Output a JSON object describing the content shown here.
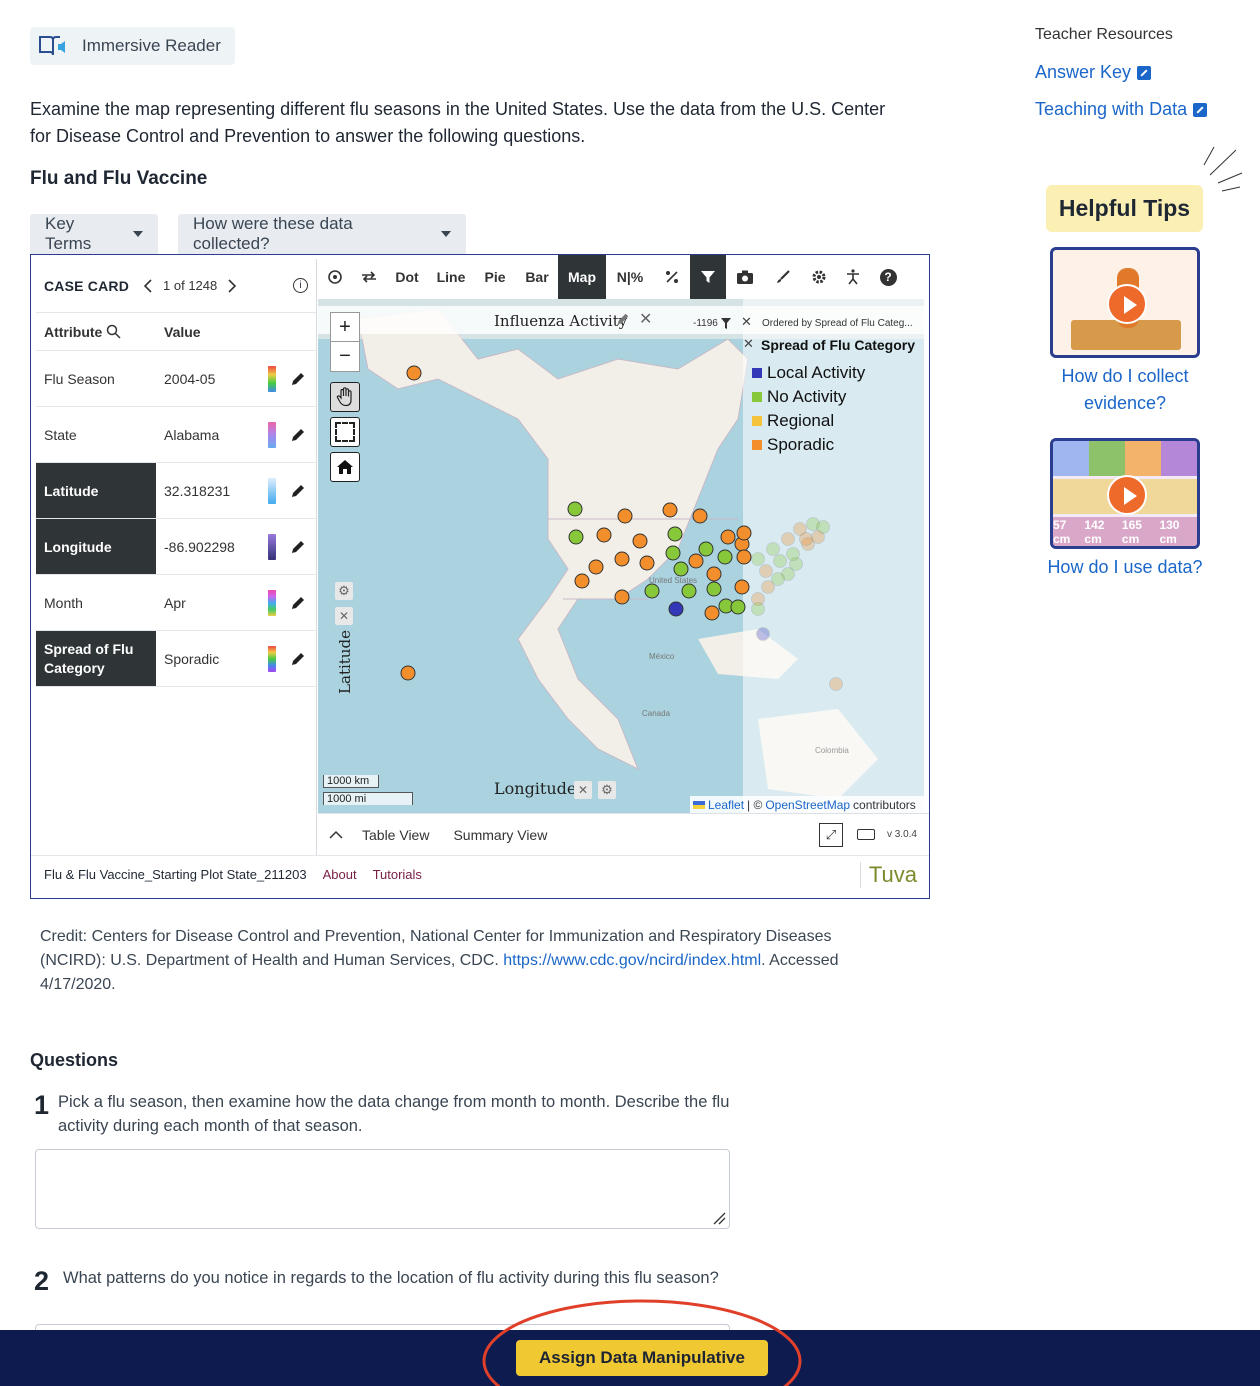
{
  "immersive_reader": {
    "label": "Immersive Reader"
  },
  "intro": "Examine the map representing different flu seasons in the United States. Use the data from the U.S. Center for Disease Control and Prevention to answer the following questions.",
  "section_title": "Flu and Flu Vaccine",
  "dropdowns": {
    "key_terms": "Key Terms",
    "data_collected": "How were these data collected?"
  },
  "case_card": {
    "title": "CASE CARD",
    "counter": "1 of 1248",
    "col_attribute": "Attribute",
    "col_value": "Value",
    "rows": [
      {
        "attr": "Flu Season",
        "value": "2004-05"
      },
      {
        "attr": "State",
        "value": "Alabama"
      },
      {
        "attr": "Latitude",
        "value": "32.318231"
      },
      {
        "attr": "Longitude",
        "value": "-86.902298"
      },
      {
        "attr": "Month",
        "value": "Apr"
      },
      {
        "attr": "Spread of Flu Category",
        "value": "Sporadic"
      }
    ]
  },
  "toolbar": {
    "dot": "Dot",
    "line": "Line",
    "pie": "Pie",
    "bar": "Bar",
    "map": "Map",
    "nsym": "N|%"
  },
  "map": {
    "title": "Influenza Activity",
    "count": "-1196",
    "ordered_by": "Ordered by Spread of Flu Categ...",
    "legend_title": "Spread of Flu Category",
    "legend": [
      {
        "label": "Local Activity",
        "color": "#3338b8"
      },
      {
        "label": "No Activity",
        "color": "#86c83a"
      },
      {
        "label": "Regional",
        "color": "#f6c43a"
      },
      {
        "label": "Sporadic",
        "color": "#f28f2c"
      }
    ],
    "canada": "Canada",
    "us": "United States",
    "mexico": "México",
    "colombia": "Colombia",
    "ylabel": "Latitude",
    "xlabel": "Longitude",
    "scale_km": "1000 km",
    "scale_mi": "1000 mi",
    "leaflet": "Leaflet",
    "osm": "OpenStreetMap",
    "contributors": "contributors"
  },
  "map_footer": {
    "table_view": "Table View",
    "summary_view": "Summary View",
    "version": "v 3.0.4"
  },
  "doc_footer": {
    "name": "Flu & Flu Vaccine_Starting Plot State_211203",
    "about": "About",
    "tutorials": "Tutorials",
    "brand": "Tuva"
  },
  "credit": {
    "text": "Credit: Centers for Disease Control and Prevention, National Center for Immunization and Respiratory Diseases (NCIRD): U.S. Department of Health and Human Services, CDC.",
    "link": "https://www.cdc.gov/ncird/index.html",
    "accessed": ". Accessed 4/17/2020."
  },
  "questions": {
    "title": "Questions",
    "items": [
      {
        "num": "1",
        "text": "Pick a flu season, then examine how the data change from month to month. Describe the flu activity during each month of that season."
      },
      {
        "num": "2",
        "text": "What patterns do you notice in regards to the location of flu activity during this flu season?"
      }
    ]
  },
  "sidebar": {
    "teacher_resources": "Teacher Resources",
    "answer_key": "Answer Key",
    "teaching_with_data": "Teaching with Data",
    "helpful_tips": "Helpful Tips",
    "video1_caption": "How do I collect evidence?",
    "video2_caption": "How do I use data?",
    "ruler_labels": [
      "57 cm",
      "142 cm",
      "165 cm",
      "130 cm"
    ]
  },
  "assign_button": "Assign Data Manipulative"
}
